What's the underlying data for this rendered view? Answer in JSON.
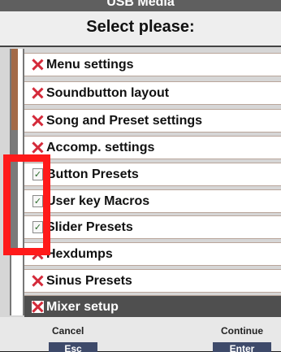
{
  "title_bar": {
    "text": "USB Media"
  },
  "dialog": {
    "title": "Select please:"
  },
  "items": [
    {
      "label": "Menu settings",
      "icon": "x-mark-icon"
    },
    {
      "label": "Soundbutton layout",
      "icon": "x-mark-icon"
    },
    {
      "label": "Song and Preset settings",
      "icon": "x-mark-icon"
    },
    {
      "label": "Accomp. settings",
      "icon": "x-mark-icon"
    },
    {
      "label": "Button Presets",
      "icon": "checked-note-icon"
    },
    {
      "label": "User key Macros",
      "icon": "checked-note-icon"
    },
    {
      "label": "Slider Presets",
      "icon": "checked-note-icon"
    },
    {
      "label": "Hexdumps",
      "icon": "x-mark-icon"
    },
    {
      "label": "Sinus Presets",
      "icon": "x-mark-icon"
    },
    {
      "label": "Mixer setup",
      "icon": "x-mark-icon",
      "selected": true
    }
  ],
  "footer": {
    "cancel_label": "Cancel",
    "cancel_key": "Esc",
    "continue_label": "Continue",
    "continue_key": "Enter"
  },
  "colors": {
    "x_mark": "#d42a3a",
    "highlight_box": "#ff1a1a",
    "selected_row": "#4f4f4f",
    "rail_brown": "#a36a48"
  }
}
